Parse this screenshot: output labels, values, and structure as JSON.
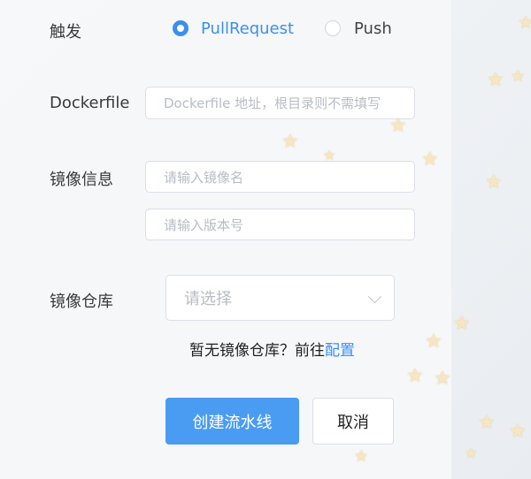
{
  "form": {
    "trigger": {
      "label": "触发",
      "options": [
        {
          "label": "PullRequest",
          "checked": true
        },
        {
          "label": "Push",
          "checked": false
        }
      ]
    },
    "dockerfile": {
      "label": "Dockerfile",
      "placeholder": "Dockerfile 地址，根目录则不需填写"
    },
    "image_info": {
      "label": "镜像信息",
      "name_placeholder": "请输入镜像名",
      "version_placeholder": "请输入版本号"
    },
    "registry": {
      "label": "镜像仓库",
      "select_placeholder": "请选择",
      "hint_text": "暂无镜像仓库？前往",
      "hint_link": "配置"
    },
    "buttons": {
      "create": "创建流水线",
      "cancel": "取消"
    }
  },
  "colors": {
    "accent": "#3b8ff0",
    "primary_button": "#4a9cf3"
  },
  "decoration": {
    "star_glyph": "★"
  }
}
